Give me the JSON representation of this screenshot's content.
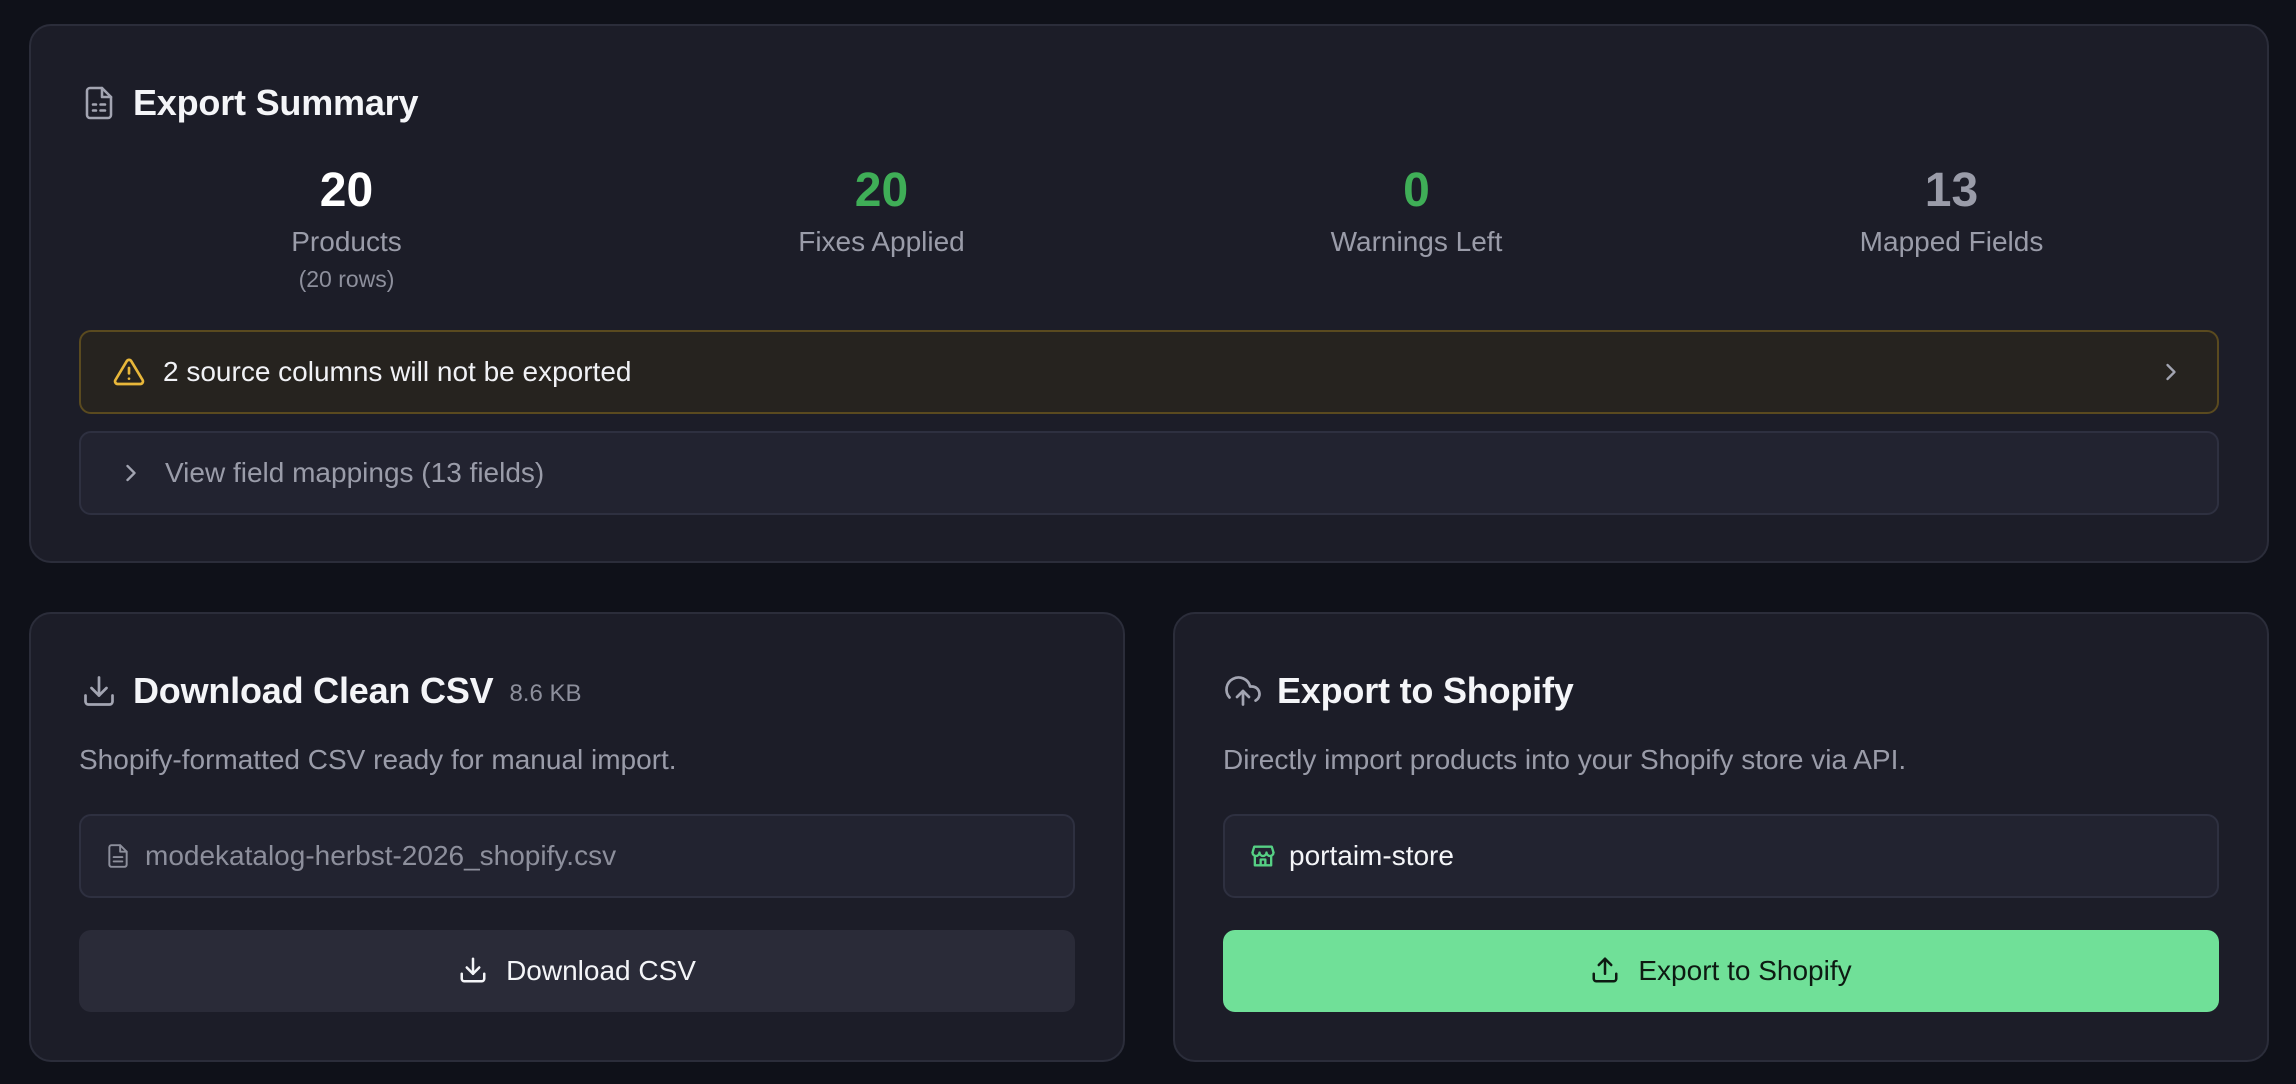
{
  "summary": {
    "title": "Export Summary",
    "stats": [
      {
        "value": "20",
        "label": "Products",
        "sub": "(20 rows)",
        "color": "#ffffff"
      },
      {
        "value": "20",
        "label": "Fixes Applied",
        "color": "#3fae57"
      },
      {
        "value": "0",
        "label": "Warnings Left",
        "color": "#3fae57"
      },
      {
        "value": "13",
        "label": "Mapped Fields",
        "color": "#9a9ca9"
      }
    ],
    "warning": "2 source columns will not be exported",
    "mappings_toggle": "View field mappings (13 fields)"
  },
  "csv": {
    "title": "Download Clean CSV",
    "size": "8.6 KB",
    "description": "Shopify-formatted CSV ready for manual import.",
    "filename": "modekatalog-herbst-2026_shopify.csv",
    "button": "Download CSV"
  },
  "shopify": {
    "title": "Export to Shopify",
    "description": "Directly import products into your Shopify store via API.",
    "store": "portaim-store",
    "button": "Export to Shopify"
  },
  "colors": {
    "accent_green": "#70e098",
    "success": "#3fae57",
    "warning": "#e8b73a"
  },
  "icons": [
    "file-text-icon",
    "alert-triangle-icon",
    "chevron-right-icon",
    "download-icon",
    "cloud-upload-icon",
    "store-icon",
    "upload-icon"
  ]
}
